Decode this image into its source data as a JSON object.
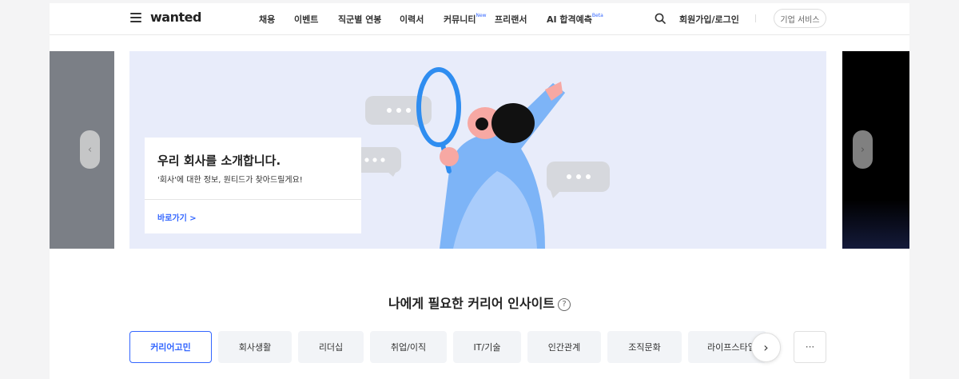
{
  "header": {
    "logo": "wanted",
    "nav": [
      {
        "label": "채용",
        "sup": ""
      },
      {
        "label": "이벤트",
        "sup": ""
      },
      {
        "label": "직군별 연봉",
        "sup": ""
      },
      {
        "label": "이력서",
        "sup": ""
      },
      {
        "label": "커뮤니티",
        "sup": "New"
      },
      {
        "label": "프리랜서",
        "sup": ""
      },
      {
        "label": "AI 합격예측",
        "sup": "Beta"
      }
    ],
    "login": "회원가입/로그인",
    "corp_service": "기업 서비스"
  },
  "carousel": {
    "prev_icon": "chevron-left-icon",
    "next_icon": "chevron-right-icon",
    "card": {
      "title": "우리 회사를 소개합니다.",
      "subtitle": "'회사'에 대한 정보, 원티드가 찾아드릴게요!",
      "link": "바로가기 >"
    }
  },
  "insight": {
    "title": "나에게 필요한 커리어 인사이트",
    "help_icon": "?",
    "chips": [
      "커리어고민",
      "회사생활",
      "리더십",
      "취업/이직",
      "IT/기술",
      "인간관계",
      "조직문화",
      "라이프스타일"
    ],
    "active_chip": "커리어고민",
    "more_label": "···"
  },
  "colors": {
    "accent": "#3366ff",
    "banner_bg": "#e8ecfa",
    "chip_bg": "#f2f4f7"
  }
}
